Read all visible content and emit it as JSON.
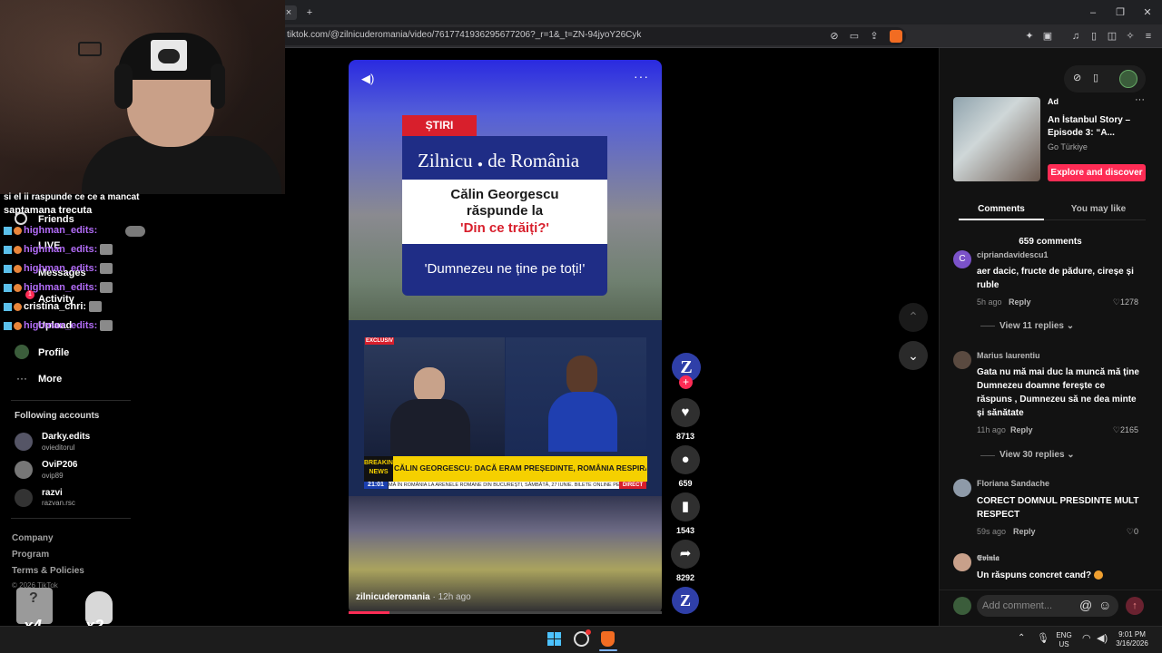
{
  "browser": {
    "url": "tiktok.com/@zilnicuderomania/video/7617741936295677206?_r=1&_t=ZN-94jyoY26Cyk",
    "tab_close": "×",
    "new_tab": "+",
    "min": "–",
    "restore": "❐",
    "close": "✕"
  },
  "sidebar": {
    "nav": [
      {
        "label": "Friends"
      },
      {
        "label": "LIVE"
      },
      {
        "label": "Messages"
      },
      {
        "label": "Activity"
      },
      {
        "label": "Upload"
      },
      {
        "label": "Profile"
      },
      {
        "label": "More"
      }
    ],
    "activity_badge": "1",
    "following_title": "Following accounts",
    "following": [
      {
        "name": "Darky.edits",
        "handle": "ovieditorul"
      },
      {
        "name": "OviP206",
        "handle": "ovip89"
      },
      {
        "name": "razvi",
        "handle": "razvan.rsc"
      }
    ],
    "footer": [
      "Company",
      "Program",
      "Terms & Policies"
    ],
    "copyright": "© 2026 TikTok"
  },
  "chat": {
    "top_text": "saptamana trecuta",
    "top_partial": "si el ii raspunde ce ce a mancat",
    "lines": [
      {
        "name": "highman_edits:"
      },
      {
        "name": "highman_edits:"
      },
      {
        "name": "highman_edits:"
      },
      {
        "name": "highman_edits:"
      },
      {
        "name": "cristina_chri:"
      },
      {
        "name": "highman_edits:"
      }
    ],
    "multipliers": [
      "x4",
      "x2"
    ],
    "question_mark": "?"
  },
  "video": {
    "stiri": "ȘTIRI",
    "brand": "Zilnicu",
    "brand2": "de România",
    "headline_1": "Călin Georgescu",
    "headline_2": "răspunde la",
    "headline_quote": "'Din ce trăiți?'",
    "quote": "'Dumnezeu ne ține pe toți!'",
    "exclusiv": "EXCLUSIV",
    "breaking_1": "BREAKING",
    "breaking_2": "NEWS",
    "ticker": "CĂLIN GEORGESCU: DACĂ ERAM PREȘEDINTE, ROMÂNIA RESPIRA PRIN JUSTIȚIE",
    "ticker_time": "21:01",
    "ticker_sub": "MĂ ÎN ROMÂNIA LA ARENELE ROMANE DIN BUCUREȘTI, SÂMBĂTĂ, 27 IUNIE. BILETE ONLINE PE I",
    "direct": "DIRECT",
    "author": "zilnicuderomania",
    "time_ago": "· 12h ago",
    "progress": 0.13
  },
  "actions": {
    "avatar_letter": "Z",
    "likes": "8713",
    "comments": "659",
    "saves": "1543",
    "shares": "8292"
  },
  "ad": {
    "label": "Ad",
    "title": "An İstanbul Story – Episode 3: “A...",
    "sponsor": "Go Türkiye",
    "cta": "Explore and discover"
  },
  "tabs": [
    {
      "label": "Comments"
    },
    {
      "label": "You may like"
    }
  ],
  "comments_count": "659 comments",
  "comments": [
    {
      "user": "cipriandavidescu1",
      "text": "aer dacic, fructe de pădure, cireșe și ruble",
      "time": "5h ago",
      "likes": "1278",
      "replies": "View 11 replies",
      "avatar_letter": "C"
    },
    {
      "user": "Marius laurentiu",
      "text": "Gata nu mă mai duc la muncă mă ține Dumnezeu doamne ferește ce răspuns , Dumnezeu să ne dea minte și sănătate",
      "time": "11h ago",
      "likes": "2165",
      "replies": "View 30 replies"
    },
    {
      "user": "Floriana Sandache",
      "text": "CORECT DOMNUL PRESDINTE MULT RESPECT",
      "time": "59s ago",
      "likes": "0"
    },
    {
      "user": "𝕰𝖛𝖎𝖓𝖎𝖆",
      "text": "Un răspuns concret cand?"
    }
  ],
  "reply_label": "Reply",
  "add_comment": {
    "placeholder": "Add comment..."
  },
  "taskbar": {
    "lang": "ENG",
    "region": "US",
    "time": "9:01 PM",
    "date": "3/16/2026"
  },
  "colors": {
    "accent": "#fe2c55",
    "username": "#b26cf7"
  }
}
